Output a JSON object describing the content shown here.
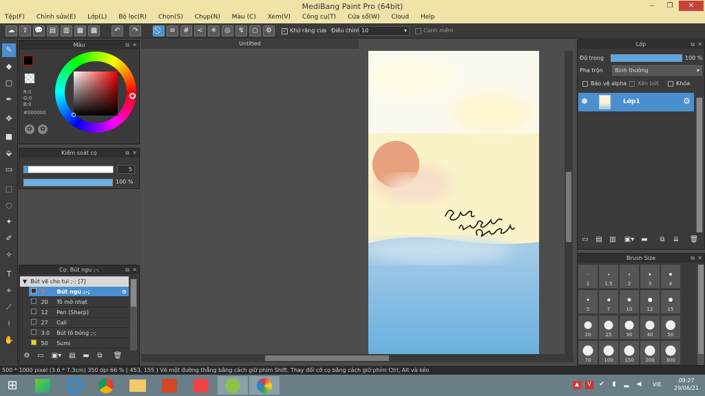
{
  "window": {
    "title": "MediBang Paint Pro (64bit)"
  },
  "menu": [
    "Tệp(F)",
    "Chỉnh sửa(E)",
    "Lớp(L)",
    "Bộ lọc(R)",
    "Chọn(S)",
    "Chụp(N)",
    "Màu (C)",
    "Xem(V)",
    "Công cụ(T)",
    "Cửa sổ(W)",
    "Cloud",
    "Help"
  ],
  "toolbar": {
    "antialias_label": "Khử răng cưa",
    "adjust_label": "Điều chỉnh",
    "adjust_value": "10",
    "edge_label": "Canh mềm"
  },
  "color_panel": {
    "title": "Màu",
    "r": "R:0",
    "g": "G:0",
    "b": "B:0",
    "hex": "#000000"
  },
  "brush_control": {
    "title": "Kiểm soát cọ",
    "size_value": "5",
    "opacity_value": "100 %",
    "size_level": 0.05,
    "opacity_level": 1.0
  },
  "brush_panel": {
    "title": "Cọ: Bút ngu ;-;",
    "group": "Bút vẽ cho tui ;-; [7]",
    "items": [
      {
        "size": "5",
        "name": "Bút ngu ;-;",
        "selected": true
      },
      {
        "size": "20",
        "name": "Tô mờ nhạt",
        "selected": false
      },
      {
        "size": "12",
        "name": "Pen (Sharp)",
        "selected": false
      },
      {
        "size": "27",
        "name": "Cali",
        "selected": false
      },
      {
        "size": "3.0",
        "name": "Bút tô bóng ;-;",
        "selected": false
      },
      {
        "size": "50",
        "name": "Sumi",
        "selected": false
      }
    ]
  },
  "document": {
    "tab": "Untitled"
  },
  "layer_panel": {
    "title": "Lớp",
    "opacity_label": "Độ trong",
    "opacity_value": "100 %",
    "blend_label": "Pha trộn",
    "blend_value": "Bình thường",
    "protect_alpha": "Bảo vệ alpha",
    "clip": "Xén bớt",
    "lock": "Khóa",
    "layer_name": "Lớp1"
  },
  "brush_size": {
    "title": "Brush Size",
    "sizes": [
      "1",
      "1.5",
      "2",
      "3",
      "4",
      "5",
      "7",
      "10",
      "12",
      "15",
      "20",
      "25",
      "30",
      "40",
      "50",
      "70",
      "100",
      "150",
      "200",
      "300"
    ]
  },
  "status": {
    "text": "500 * 1000 pixel  (3.6 * 7.3cm)  350 dpi  66 %  ( 453, 155 )  Vẽ một đường thẳng bằng cách giữ phím Shift, Thay đổi cỡ cọ bằng cách giữ phím Ctrl, Alt và kéo"
  },
  "taskbar": {
    "lang": "VIE",
    "time": "09:27",
    "date": "29/06/21"
  }
}
